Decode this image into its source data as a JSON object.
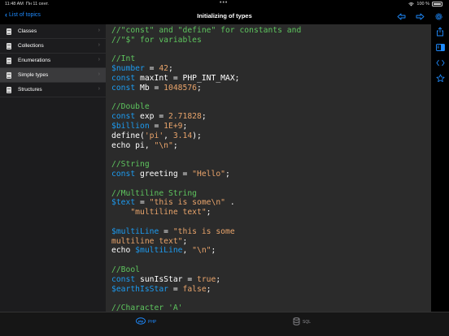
{
  "status": {
    "time": "11:48 AM",
    "date": "Пн 11 сент.",
    "battery": "100 %"
  },
  "nav": {
    "back_label": "List of topics",
    "title": "Initializing of types"
  },
  "sidebar": {
    "items": [
      {
        "label": "Classes"
      },
      {
        "label": "Collections"
      },
      {
        "label": "Enumerations"
      },
      {
        "label": "Simple types",
        "selected": true
      },
      {
        "label": "Structures"
      }
    ]
  },
  "code_lines": [
    [
      [
        "//\"const\" and \"define\" for constants and",
        "c"
      ]
    ],
    [
      [
        "//\"$\" for variables",
        "c"
      ]
    ],
    [
      [
        "",
        "t"
      ]
    ],
    [
      [
        "//Int",
        "c"
      ]
    ],
    [
      [
        "$number",
        "v"
      ],
      [
        " = ",
        "t"
      ],
      [
        "42",
        "n"
      ],
      [
        ";",
        "t"
      ]
    ],
    [
      [
        "const",
        "k"
      ],
      [
        " maxInt = PHP_INT_MAX;",
        "t"
      ]
    ],
    [
      [
        "const",
        "k"
      ],
      [
        " Mb = ",
        "t"
      ],
      [
        "1048576",
        "n"
      ],
      [
        ";",
        "t"
      ]
    ],
    [
      [
        "",
        "t"
      ]
    ],
    [
      [
        "//Double",
        "c"
      ]
    ],
    [
      [
        "const",
        "k"
      ],
      [
        " exp = ",
        "t"
      ],
      [
        "2.71828",
        "n"
      ],
      [
        ";",
        "t"
      ]
    ],
    [
      [
        "$billion",
        "v"
      ],
      [
        " = ",
        "t"
      ],
      [
        "1E+9",
        "n"
      ],
      [
        ";",
        "t"
      ]
    ],
    [
      [
        "define(",
        "t"
      ],
      [
        "'pi'",
        "s"
      ],
      [
        ", ",
        "t"
      ],
      [
        "3.14",
        "n"
      ],
      [
        ");",
        "t"
      ]
    ],
    [
      [
        "echo pi, ",
        "t"
      ],
      [
        "\"\\n\"",
        "s"
      ],
      [
        ";",
        "t"
      ]
    ],
    [
      [
        "",
        "t"
      ]
    ],
    [
      [
        "//String",
        "c"
      ]
    ],
    [
      [
        "const",
        "k"
      ],
      [
        " greeting = ",
        "t"
      ],
      [
        "\"Hello\"",
        "s"
      ],
      [
        ";",
        "t"
      ]
    ],
    [
      [
        "",
        "t"
      ]
    ],
    [
      [
        "//Multiline String",
        "c"
      ]
    ],
    [
      [
        "$text",
        "v"
      ],
      [
        " = ",
        "t"
      ],
      [
        "\"this is some\\n\"",
        "s"
      ],
      [
        " .",
        "t"
      ]
    ],
    [
      [
        "    ",
        "t"
      ],
      [
        "\"multiline text\"",
        "s"
      ],
      [
        ";",
        "t"
      ]
    ],
    [
      [
        "",
        "t"
      ]
    ],
    [
      [
        "$multiLine",
        "v"
      ],
      [
        " = ",
        "t"
      ],
      [
        "\"this is some",
        "s"
      ]
    ],
    [
      [
        "multiline text\"",
        "s"
      ],
      [
        ";",
        "t"
      ]
    ],
    [
      [
        "echo ",
        "t"
      ],
      [
        "$multiLine",
        "v"
      ],
      [
        ", ",
        "t"
      ],
      [
        "\"\\n\"",
        "s"
      ],
      [
        ";",
        "t"
      ]
    ],
    [
      [
        "",
        "t"
      ]
    ],
    [
      [
        "//Bool",
        "c"
      ]
    ],
    [
      [
        "const",
        "k"
      ],
      [
        " sunIsStar = ",
        "t"
      ],
      [
        "true",
        "n"
      ],
      [
        ";",
        "t"
      ]
    ],
    [
      [
        "$earthIsStar",
        "v"
      ],
      [
        " = ",
        "t"
      ],
      [
        "false",
        "n"
      ],
      [
        ";",
        "t"
      ]
    ],
    [
      [
        "",
        "t"
      ]
    ],
    [
      [
        "//Character 'A'",
        "c"
      ]
    ]
  ],
  "token_colors": {
    "c": "#5ec55e",
    "k": "#1d9bf0",
    "v": "#1d9bf0",
    "n": "#e9a46b",
    "s": "#e9a46b",
    "t": "#ffffff"
  },
  "tabs": [
    {
      "label": "PHP",
      "icon": "php-icon",
      "active": true
    },
    {
      "label": "SQL",
      "icon": "database-icon",
      "active": false
    }
  ],
  "accent_color": "#1e8bff"
}
